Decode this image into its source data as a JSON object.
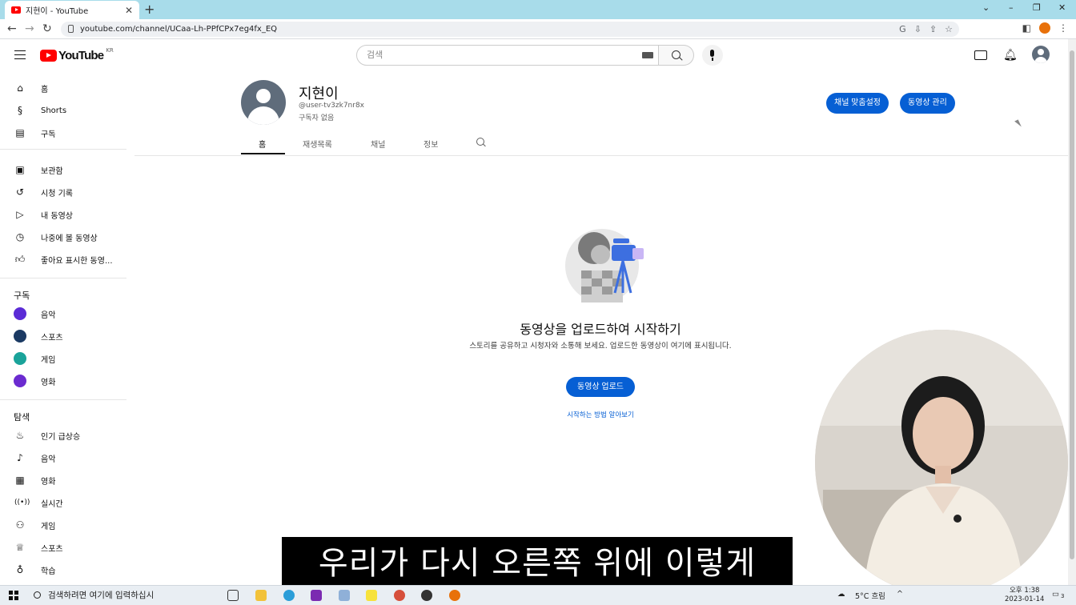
{
  "browser": {
    "tab_title": "지현이 - YouTube",
    "tab_close": "✕",
    "new_tab": "+",
    "url": "youtube.com/channel/UCaa-Lh-PPfCPx7eg4fx_EQ",
    "window_controls": [
      "⌄",
      "–",
      "❐",
      "✕"
    ]
  },
  "header": {
    "logo_text": "YouTube",
    "logo_region": "KR",
    "search_placeholder": "검색"
  },
  "sidebar": {
    "main": [
      {
        "label": "홈",
        "icon": "home-icon"
      },
      {
        "label": "Shorts",
        "icon": "shorts-icon"
      },
      {
        "label": "구독",
        "icon": "subscriptions-icon"
      }
    ],
    "library": [
      {
        "label": "보관함",
        "icon": "library-icon"
      },
      {
        "label": "시청 기록",
        "icon": "history-icon"
      },
      {
        "label": "내 동영상",
        "icon": "my-videos-icon"
      },
      {
        "label": "나중에 볼 동영상",
        "icon": "watch-later-icon"
      },
      {
        "label": "좋아요 표시한 동영...",
        "icon": "liked-icon"
      }
    ],
    "subscriptions_title": "구독",
    "subscriptions": [
      {
        "label": "음악",
        "color": "#5b2bd6"
      },
      {
        "label": "스포츠",
        "color": "#1b3a63"
      },
      {
        "label": "게임",
        "color": "#1aa39a"
      },
      {
        "label": "영화",
        "color": "#6b2bd0"
      }
    ],
    "explore_title": "탐색",
    "explore": [
      {
        "label": "인기 급상승",
        "icon": "trending-icon"
      },
      {
        "label": "음악",
        "icon": "music-icon"
      },
      {
        "label": "영화",
        "icon": "movies-icon"
      },
      {
        "label": "실시간",
        "icon": "live-icon"
      },
      {
        "label": "게임",
        "icon": "gaming-icon"
      },
      {
        "label": "스포츠",
        "icon": "sports-icon"
      },
      {
        "label": "학습",
        "icon": "learning-icon"
      }
    ]
  },
  "channel": {
    "name": "지현이",
    "handle": "@user-tv3zk7nr8x",
    "subscribers": "구독자 없음",
    "customize_button": "채널 맞춤설정",
    "manage_button": "동영상 관리",
    "tabs": [
      "홈",
      "재생목록",
      "채널",
      "정보"
    ]
  },
  "empty_state": {
    "title": "동영상을 업로드하여 시작하기",
    "description": "스토리를 공유하고 시청자와 소통해 보세요. 업로드한 동영상이 여기에 표시됩니다.",
    "upload_button": "동영상 업로드",
    "learn_link": "시작하는 방법 알아보기"
  },
  "subtitle": "우리가 다시 오른쪽 위에 이렇게",
  "taskbar": {
    "search_placeholder": "검색하려면 여기에 입력하십시",
    "weather": "5°C 흐림",
    "time": "오후 1:38",
    "date": "2023-01-14",
    "notification_count": "3"
  },
  "colors": {
    "accent_blue": "#065fd4",
    "youtube_red": "#ff0000",
    "tabstrip": "#a8dcea"
  }
}
